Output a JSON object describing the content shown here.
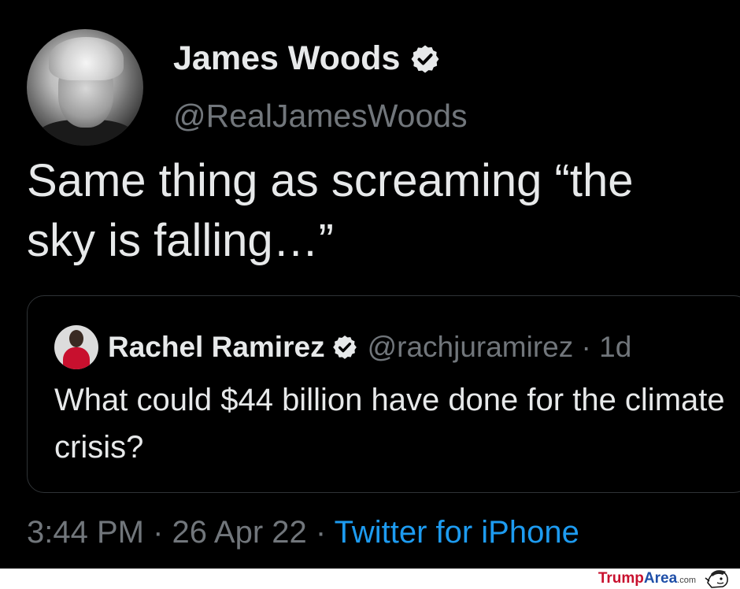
{
  "tweet": {
    "author": {
      "name": "James Woods",
      "handle": "@RealJamesWoods",
      "verified_icon": "verified-badge-icon"
    },
    "text_line1": "Same thing as screaming “the",
    "text_line2": "sky is falling…”",
    "quoted": {
      "name": "Rachel Ramirez",
      "handle_time": "@rachjuramirez · 1d",
      "text": "What could $44 billion have done for the climate crisis?"
    },
    "time_date": "3:44 PM · 26 Apr 22 · ",
    "source": "Twitter for iPhone"
  },
  "watermark": {
    "part1": "Trump",
    "part2": "Area",
    "part3": ".com"
  },
  "colors": {
    "background": "#000000",
    "text": "#e7e9ea",
    "secondary": "#71767b",
    "link": "#1d9bf0"
  }
}
